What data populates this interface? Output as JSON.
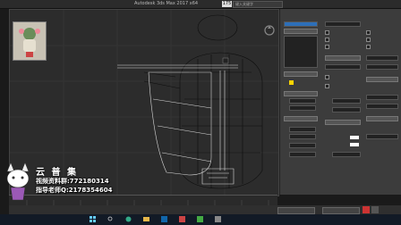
{
  "app": {
    "window_title": "Autodesk 3ds Max 2017 x64",
    "file_name": "",
    "frame_badge": "175",
    "search_placeholder": "键入关键字"
  },
  "viewport": {
    "label": ""
  },
  "watermark": {
    "brand": "云 普 集",
    "line1": "视频资料群:772180314",
    "line2": "指导老师Q:2178354604"
  },
  "colors": {
    "accent": "#ffd400",
    "wire": "#d9d9d9",
    "viewport_bg": "#2c2c2c",
    "panel_bg": "#3c3c3c",
    "taskbar_bg": "#121a26"
  },
  "icons": [
    "home-icon",
    "search-icon",
    "windows-icon",
    "browser-icon",
    "folder-icon",
    "app-icon"
  ]
}
